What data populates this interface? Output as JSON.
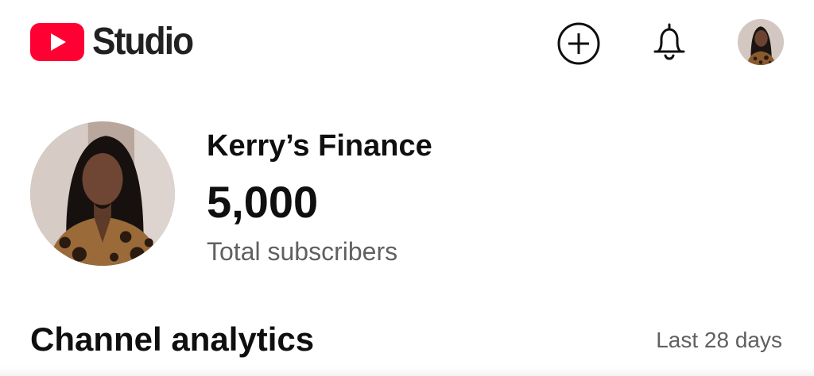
{
  "header": {
    "logo_text": "Studio",
    "brand_color": "#ff0033",
    "icons": [
      "create-icon",
      "notifications-bell-icon",
      "account-avatar"
    ]
  },
  "channel": {
    "name": "Kerry’s Finance",
    "subscriber_count": "5,000",
    "subscriber_label": "Total subscribers"
  },
  "analytics": {
    "title": "Channel analytics",
    "range": "Last 28 days"
  }
}
